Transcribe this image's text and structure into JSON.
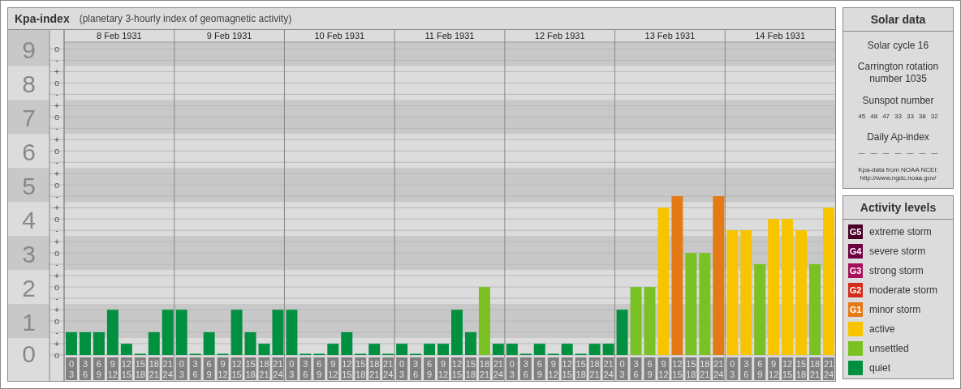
{
  "chart_panel": {
    "title": "Kpa-index",
    "subtitle": "(planetary 3-hourly index of geomagnetic activity)",
    "days": [
      "8 Feb 1931",
      "9 Feb 1931",
      "10 Feb 1931",
      "11 Feb 1931",
      "12 Feb 1931",
      "13 Feb 1931",
      "14 Feb 1931"
    ],
    "minor_ticks": [
      "o",
      "-",
      "+",
      "o",
      "-",
      "+",
      "o",
      "-",
      "+",
      "o",
      "-",
      "+",
      "o",
      "-",
      "+",
      "o",
      "-",
      "+",
      "o",
      "-",
      "+",
      "o",
      "-",
      "+",
      "o",
      "-",
      "+",
      "o"
    ],
    "chart_data": {
      "type": "bar",
      "grid": true,
      "categories": [
        "0 3",
        "3 6",
        "6 9",
        "9 12",
        "12 15",
        "15 18",
        "18 21",
        "21 24",
        "0 3",
        "3 6",
        "6 9",
        "9 12",
        "12 15",
        "15 18",
        "18 21",
        "21 24",
        "0 3",
        "3 6",
        "6 9",
        "9 12",
        "12 15",
        "15 18",
        "18 21",
        "21 24",
        "0 3",
        "3 6",
        "6 9",
        "9 12",
        "12 15",
        "15 18",
        "18 21",
        "21 24",
        "0 3",
        "3 6",
        "6 9",
        "9 12",
        "12 15",
        "15 18",
        "18 21",
        "21 24",
        "0 3",
        "3 6",
        "6 9",
        "9 12",
        "12 15",
        "15 18",
        "18 21",
        "21 24",
        "0 3",
        "3 6",
        "6 9",
        "9 12",
        "12 15",
        "15 18",
        "18 21",
        "21 24"
      ],
      "values": [
        0.67,
        0.67,
        0.67,
        1.33,
        0.33,
        0,
        0.67,
        1.33,
        1.33,
        0,
        0.67,
        0,
        1.33,
        0.67,
        0.33,
        1.33,
        1.33,
        0,
        0,
        0.33,
        0.67,
        0,
        0.33,
        0,
        0.33,
        0,
        0.33,
        0.33,
        1.33,
        0.67,
        2,
        0.33,
        0.33,
        0,
        0.33,
        0,
        0.33,
        0,
        0.33,
        0.33,
        1.33,
        2,
        2,
        4.33,
        4.67,
        3,
        3,
        4.67,
        3.67,
        3.67,
        2.67,
        4,
        4,
        3.67,
        2.67,
        4.33
      ],
      "bands": [
        {
          "axis": "y",
          "from": 0.5,
          "to": 1.5,
          "color": "#c8c8c8"
        },
        {
          "axis": "y",
          "from": 2.5,
          "to": 3.5,
          "color": "#c8c8c8"
        },
        {
          "axis": "y",
          "from": 4.5,
          "to": 5.5,
          "color": "#c8c8c8"
        },
        {
          "axis": "y",
          "from": 6.5,
          "to": 7.5,
          "color": "#c8c8c8"
        },
        {
          "axis": "y",
          "from": 8.5,
          "to": 9.2,
          "color": "#c8c8c8"
        }
      ],
      "ylim": [
        0,
        9.2
      ],
      "yticks": [
        0,
        1,
        2,
        3,
        4,
        5,
        6,
        7,
        8,
        9
      ]
    }
  },
  "solar_data": {
    "title": "Solar data",
    "solar_cycle": "Solar cycle 16",
    "carrington": "Carrington rotation number 1035",
    "sunspot_title": "Sunspot number",
    "sunspot_numbers": [
      "45",
      "48",
      "47",
      "33",
      "33",
      "38",
      "32"
    ],
    "ap_title": "Daily Ap-index",
    "ap_values": [
      "—",
      "—",
      "—",
      "—",
      "—",
      "—",
      "—"
    ],
    "source": "Kpa-data from NOAA NCEI: http://www.ngdc.noaa.gov/"
  },
  "activity_levels": {
    "title": "Activity levels",
    "items": [
      {
        "code": "G5",
        "label": "extreme storm",
        "color": "#4a0026"
      },
      {
        "code": "G4",
        "label": "severe storm",
        "color": "#6e0040"
      },
      {
        "code": "G3",
        "label": "strong storm",
        "color": "#a8105e"
      },
      {
        "code": "G2",
        "label": "moderate storm",
        "color": "#d42c1c"
      },
      {
        "code": "G1",
        "label": "minor storm",
        "color": "#e47a16"
      },
      {
        "label": "active",
        "color": "#f8c400"
      },
      {
        "label": "unsettled",
        "color": "#7ac123"
      },
      {
        "label": "quiet",
        "color": "#009040"
      }
    ]
  }
}
